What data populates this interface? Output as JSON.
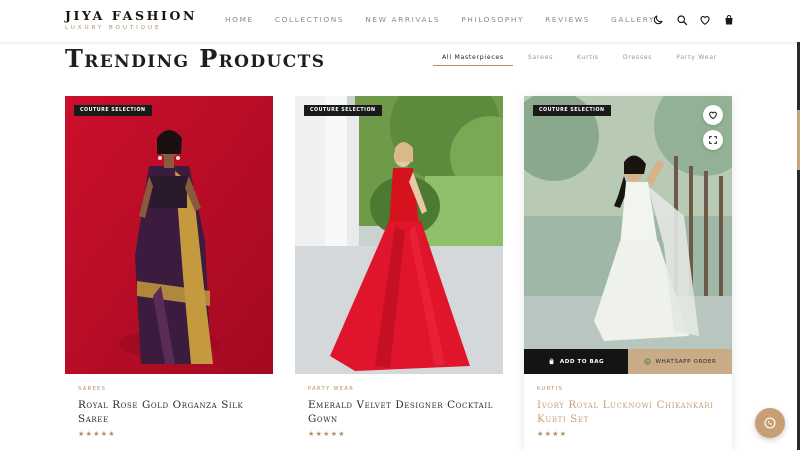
{
  "brand": {
    "name": "JIYA FASHION",
    "tagline": "LUXURY BOUTIQUE"
  },
  "nav": [
    "HOME",
    "COLLECTIONS",
    "NEW ARRIVALS",
    "PHILOSOPHY",
    "REVIEWS",
    "GALLERY"
  ],
  "header_icons": [
    "moon-icon",
    "search-icon",
    "heart-icon",
    "shopping-bag-icon"
  ],
  "section": {
    "title": "Trending Products",
    "filters": [
      "All Masterpieces",
      "Sarees",
      "Kurtis",
      "Dresses",
      "Party Wear"
    ],
    "active_filter": "All Masterpieces"
  },
  "products": [
    {
      "badge": "COUTURE SELECTION",
      "category": "SAREES",
      "name": "Royal Rose Gold Organza Silk Saree",
      "stars": "★★★★★"
    },
    {
      "badge": "COUTURE SELECTION",
      "category": "PARTY WEAR",
      "name": "Emerald Velvet Designer Cocktail Gown",
      "stars": "★★★★★"
    },
    {
      "badge": "COUTURE SELECTION",
      "category": "KURTIS",
      "name": "Ivory Royal Lucknowi Chikankari Kurti Set",
      "stars": "★★★★"
    }
  ],
  "card_actions": {
    "add_to_bag": "ADD TO BAG",
    "whatsapp": "WHATSAPP ORDER"
  },
  "colors": {
    "accent": "#b48e62",
    "dark": "#141414",
    "whatsapp_btn": "#c9ab86",
    "float_btn": "#c79f74"
  }
}
